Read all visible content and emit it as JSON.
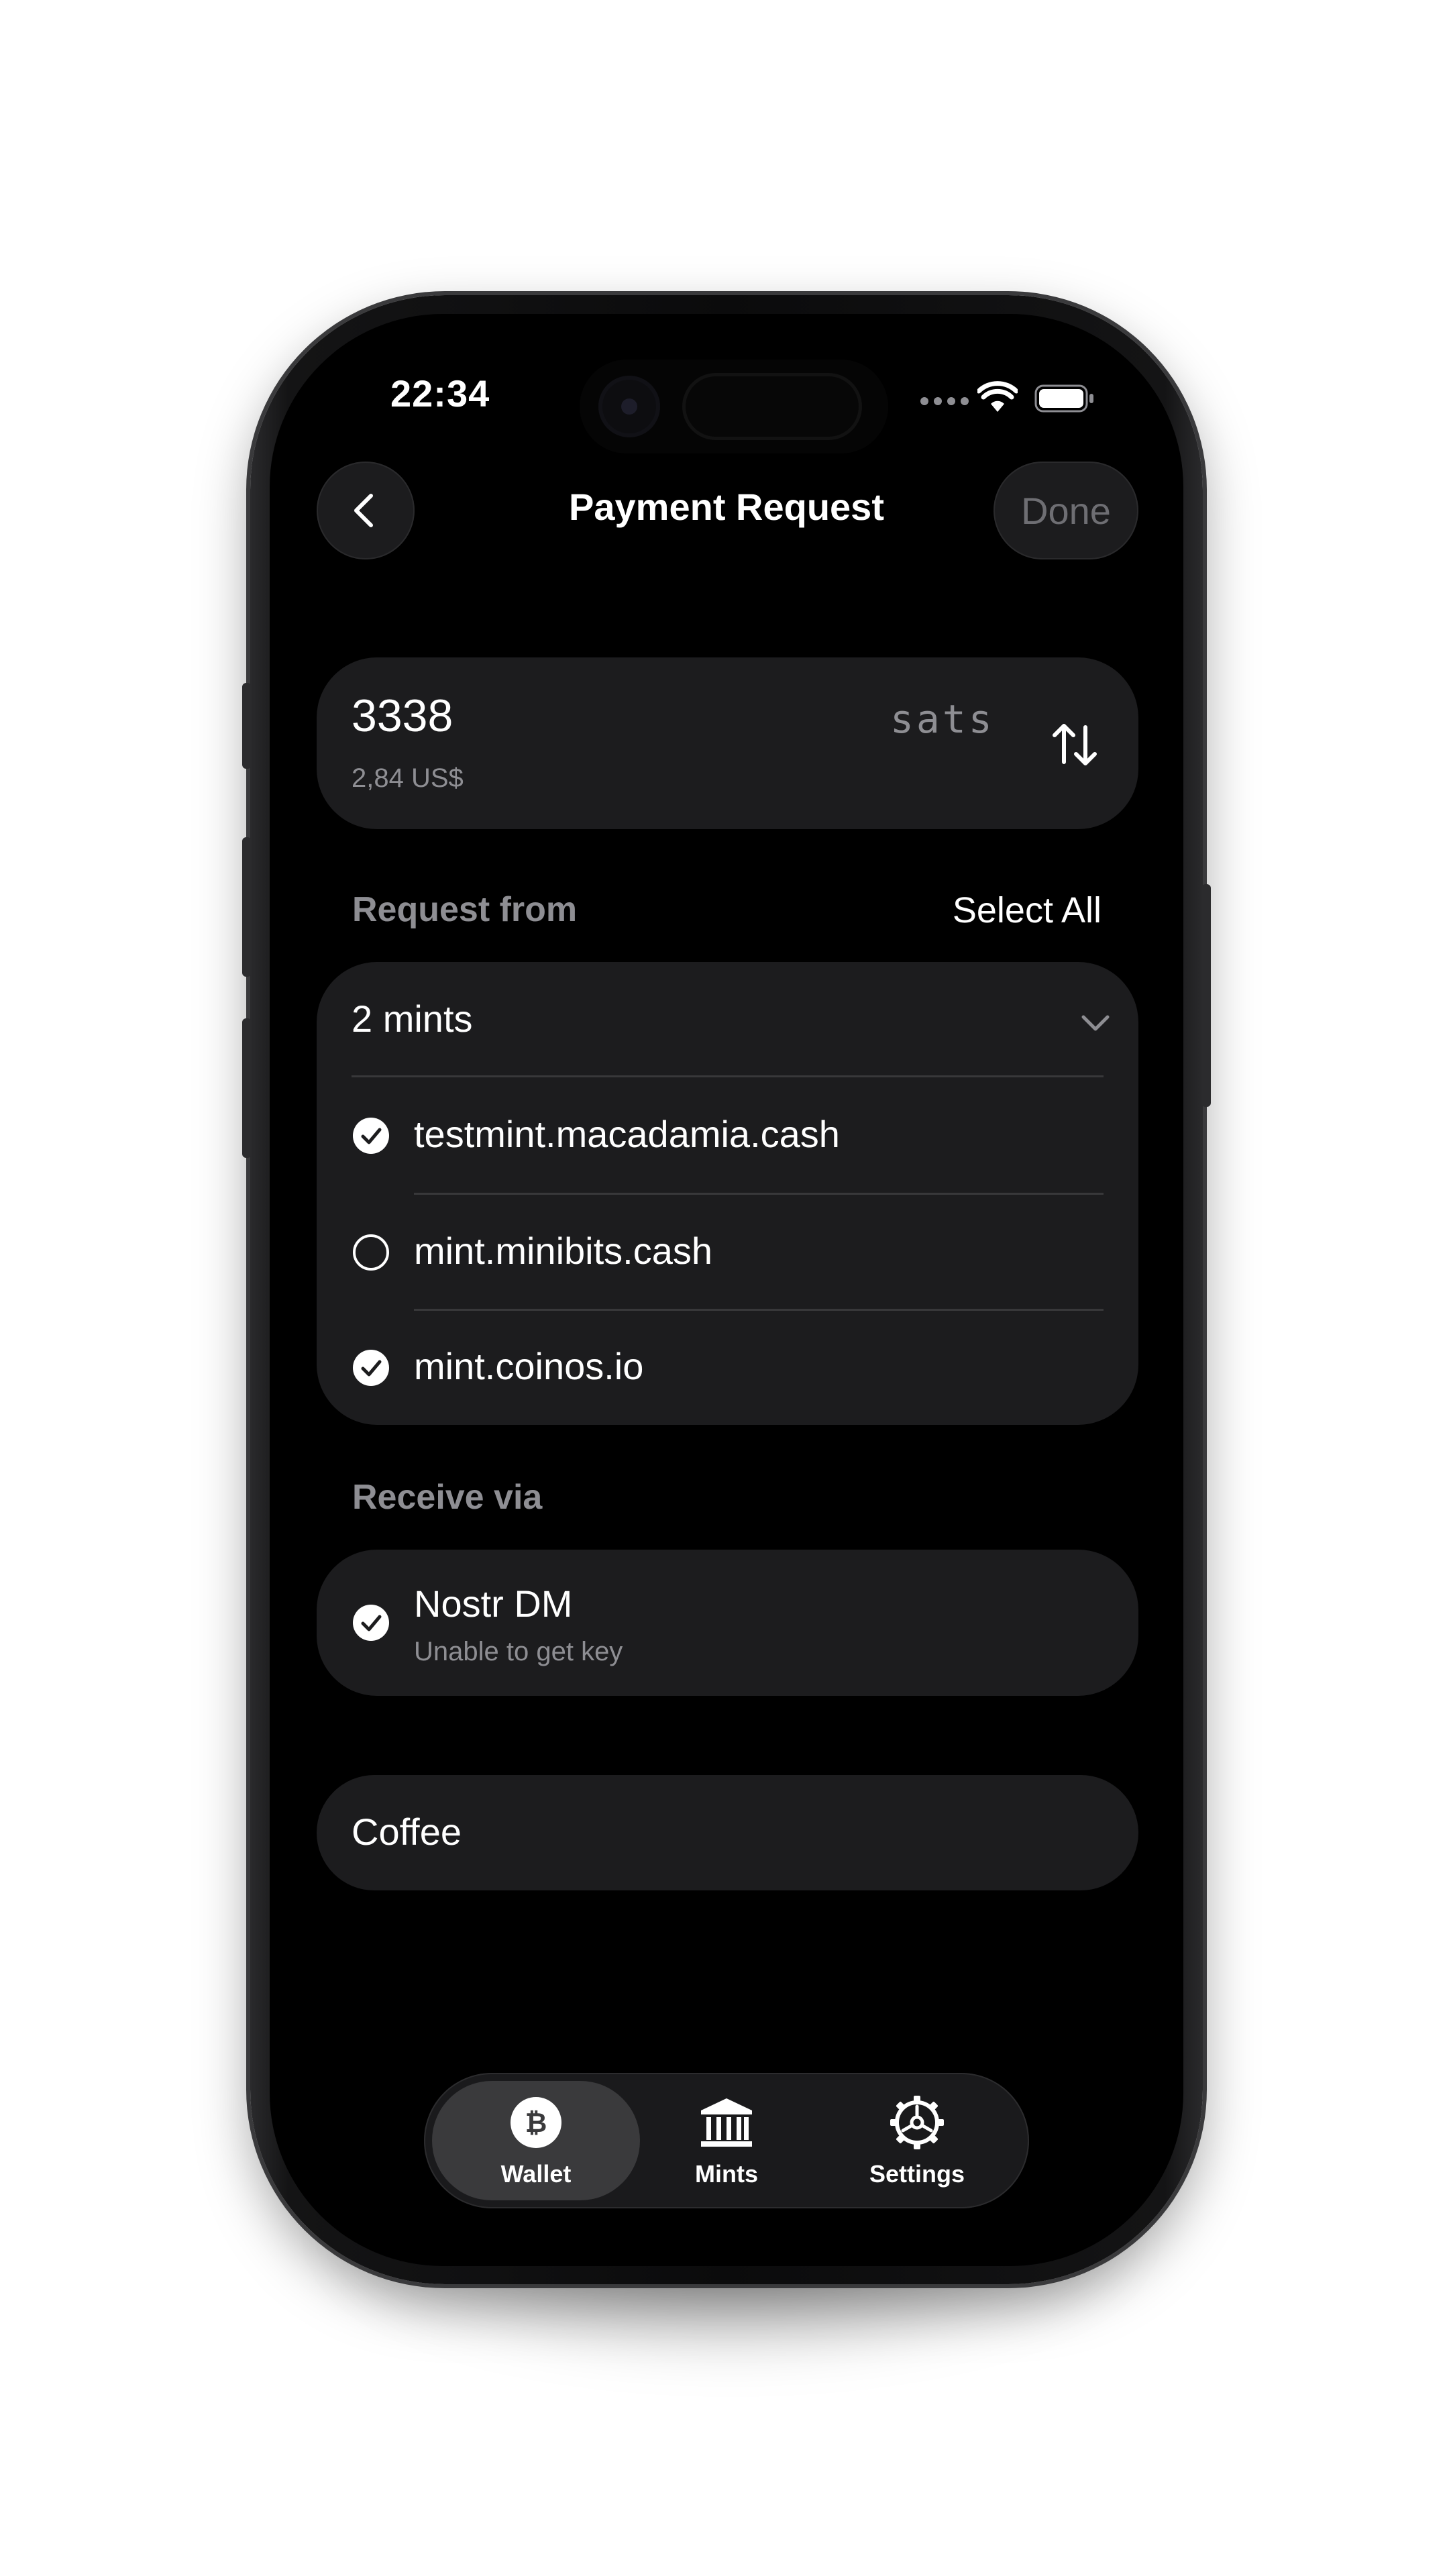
{
  "status_bar": {
    "time": "22:34"
  },
  "nav": {
    "title": "Payment Request",
    "done_label": "Done"
  },
  "amount": {
    "value": "3338",
    "unit": "sats",
    "fiat": "2,84 US$"
  },
  "request_from": {
    "label": "Request from",
    "select_all_label": "Select All",
    "summary": "2 mints",
    "mints": [
      {
        "name": "testmint.macadamia.cash",
        "selected": true
      },
      {
        "name": "mint.minibits.cash",
        "selected": false
      },
      {
        "name": "mint.coinos.io",
        "selected": true
      }
    ]
  },
  "receive_via": {
    "label": "Receive via",
    "method": "Nostr DM",
    "method_status": "Unable to get key",
    "selected": true
  },
  "memo": {
    "value": "Coffee"
  },
  "tabbar": {
    "tabs": [
      {
        "label": "Wallet",
        "icon": "bitcoin-icon",
        "active": true
      },
      {
        "label": "Mints",
        "icon": "bank-icon",
        "active": false
      },
      {
        "label": "Settings",
        "icon": "gear-icon",
        "active": false
      }
    ]
  },
  "colors": {
    "background": "#000000",
    "card": "#1c1c1e",
    "secondary_text": "#8e8e93",
    "active_tab": "#3a3a3c"
  }
}
